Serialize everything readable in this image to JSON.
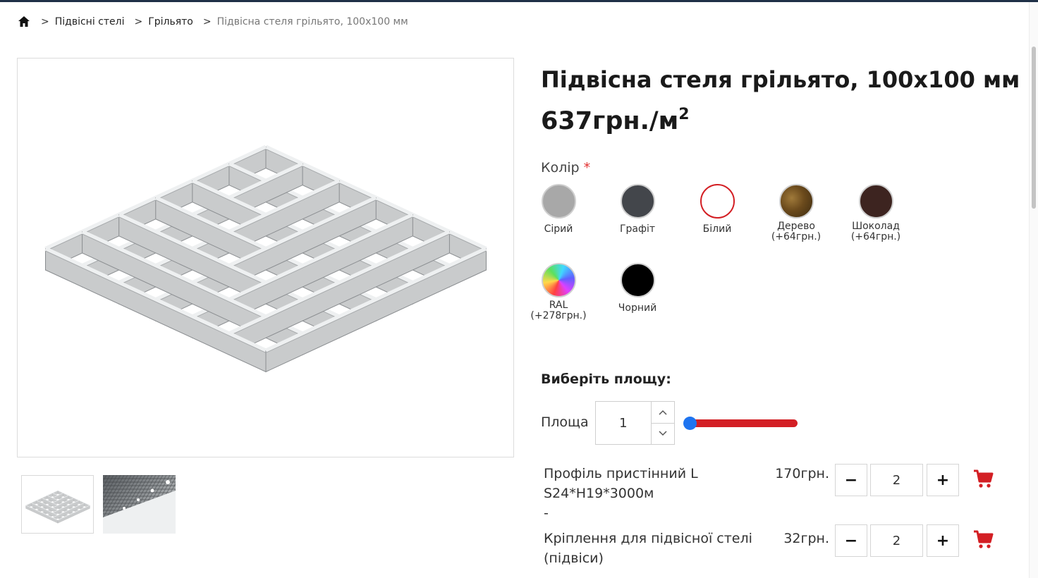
{
  "breadcrumb": {
    "home_icon": "home-icon",
    "separator": ">",
    "items": [
      "Підвісні стелі",
      "Грільято"
    ],
    "current": "Підвісна стеля грільято, 100х100 мм"
  },
  "product": {
    "title": "Підвісна стеля грільято, 100х100 мм",
    "price": "637грн./м",
    "price_sup": "2"
  },
  "color": {
    "label": "Колір",
    "required_mark": "*",
    "selected": "Білий",
    "options": [
      {
        "name": "Сірий",
        "extra": "",
        "color": "#a8a8a8"
      },
      {
        "name": "Графіт",
        "extra": "",
        "color": "#43464b"
      },
      {
        "name": "Білий",
        "extra": "",
        "color": "#ffffff"
      },
      {
        "name": "Дерево",
        "extra": "(+64грн.)",
        "color": "#6b4a1c"
      },
      {
        "name": "Шоколад",
        "extra": "(+64грн.)",
        "color": "#3d2420"
      },
      {
        "name": "RAL",
        "extra": "(+278грн.)",
        "color": "rainbow"
      },
      {
        "name": "Чорний",
        "extra": "",
        "color": "#000000"
      }
    ]
  },
  "area": {
    "heading": "Виберіть площу:",
    "label": "Площа",
    "value": "1",
    "slider_fraction": 0.0,
    "slider_track_color": "#d31f24",
    "slider_knob_color": "#1e74f0"
  },
  "accessories": [
    {
      "name": "Профіль пристінний L S24*H19*3000м",
      "note": "-",
      "price": "170грн.",
      "qty": "2"
    },
    {
      "name": "Кріплення для підвісної стелі (підвіси)",
      "note": "",
      "price": "32грн.",
      "qty": "2"
    }
  ],
  "buttons": {
    "minus": "−",
    "plus": "+"
  },
  "colors": {
    "accent": "#d31f24",
    "topline": "#1f3047"
  }
}
